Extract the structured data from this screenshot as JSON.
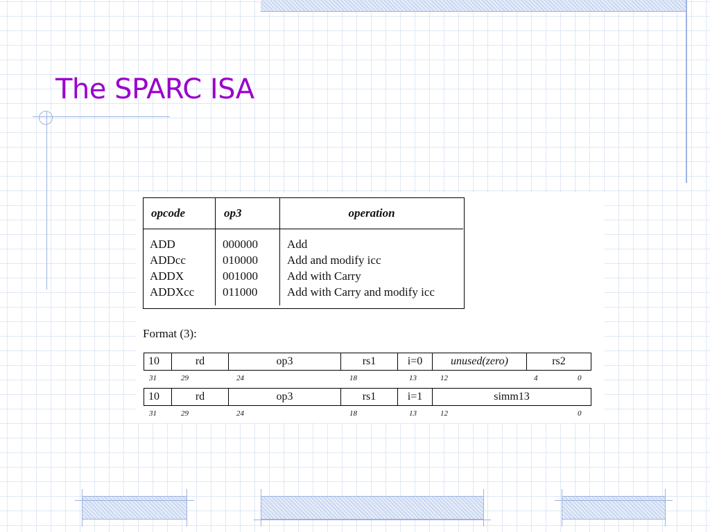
{
  "slide": {
    "title": "The SPARC ISA"
  },
  "opcode_table": {
    "headers": [
      "opcode",
      "op3",
      "operation"
    ],
    "rows": [
      [
        "ADD",
        "000000",
        "Add"
      ],
      [
        "ADDcc",
        "010000",
        "Add and modify icc"
      ],
      [
        "ADDX",
        "001000",
        "Add with Carry"
      ],
      [
        "ADDXcc",
        "011000",
        "Add with Carry and modify icc"
      ]
    ]
  },
  "format": {
    "label": "Format (3):",
    "row1": {
      "fields": [
        "10",
        "rd",
        "op3",
        "rs1",
        "i=0",
        "unused(zero)",
        "rs2"
      ],
      "bits": [
        "31",
        "29",
        "24",
        "18",
        "13",
        "12",
        "4",
        "0"
      ]
    },
    "row2": {
      "fields": [
        "10",
        "rd",
        "op3",
        "rs1",
        "i=1",
        "simm13"
      ],
      "bits": [
        "31",
        "29",
        "24",
        "18",
        "13",
        "12",
        "0"
      ]
    }
  },
  "colors": {
    "title": "#9900cc",
    "grid": "#dfe7f5",
    "accent": "#9db2e0"
  }
}
